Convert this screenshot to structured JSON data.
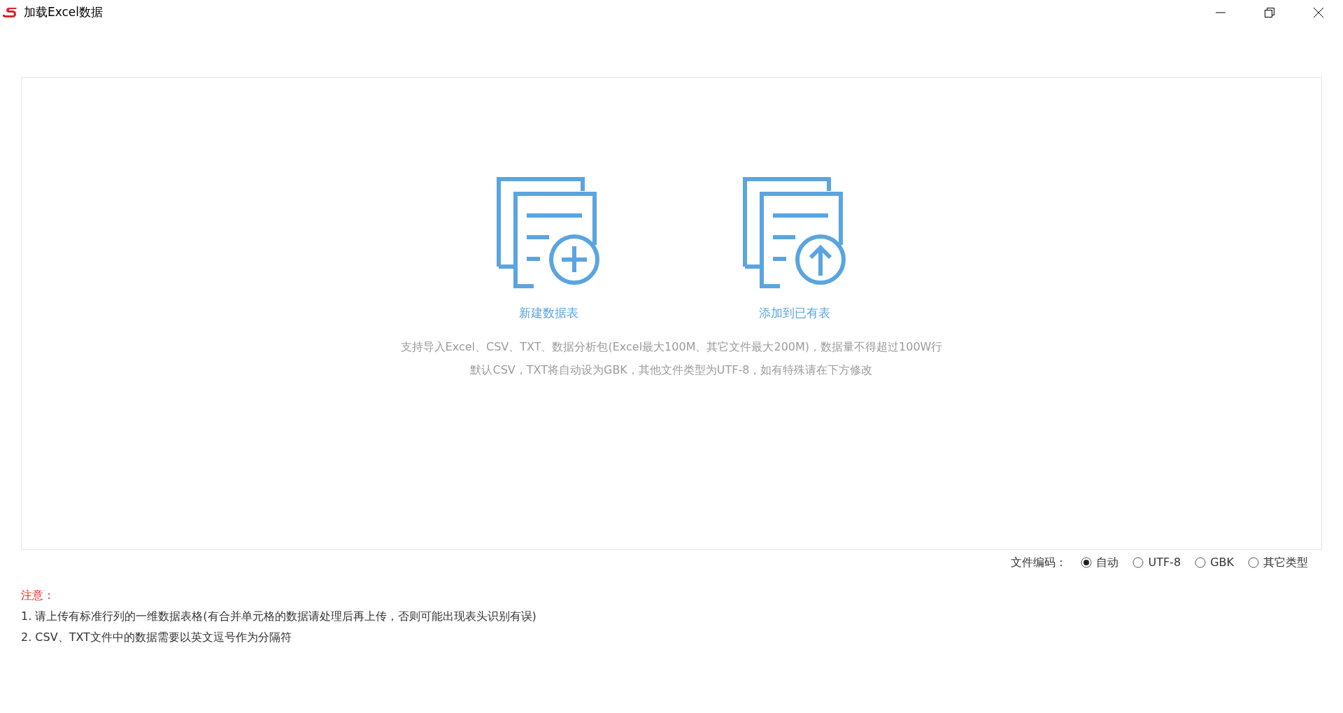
{
  "window": {
    "title": "加载Excel数据"
  },
  "actions": [
    {
      "kind": "new",
      "label": "新建数据表"
    },
    {
      "kind": "upload",
      "label": "添加到已有表"
    }
  ],
  "description": [
    "支持导入Excel、CSV、TXT、数据分析包(Excel最大100M、其它文件最大200M)，数据量不得超过100W行",
    "默认CSV，TXT将自动设为GBK，其他文件类型为UTF-8，如有特殊请在下方修改"
  ],
  "encoding": {
    "label": "文件编码：",
    "options": [
      {
        "label": "自动",
        "selected": true
      },
      {
        "label": "UTF-8",
        "selected": false
      },
      {
        "label": "GBK",
        "selected": false
      },
      {
        "label": "其它类型",
        "selected": false
      }
    ]
  },
  "notes": {
    "title": "注意：",
    "items": [
      "1. 请上传有标准行列的一维数据表格(有合并单元格的数据请处理后再上传，否则可能出现表头识别有误)",
      "2. CSV、TXT文件中的数据需要以英文逗号作为分隔符"
    ]
  }
}
